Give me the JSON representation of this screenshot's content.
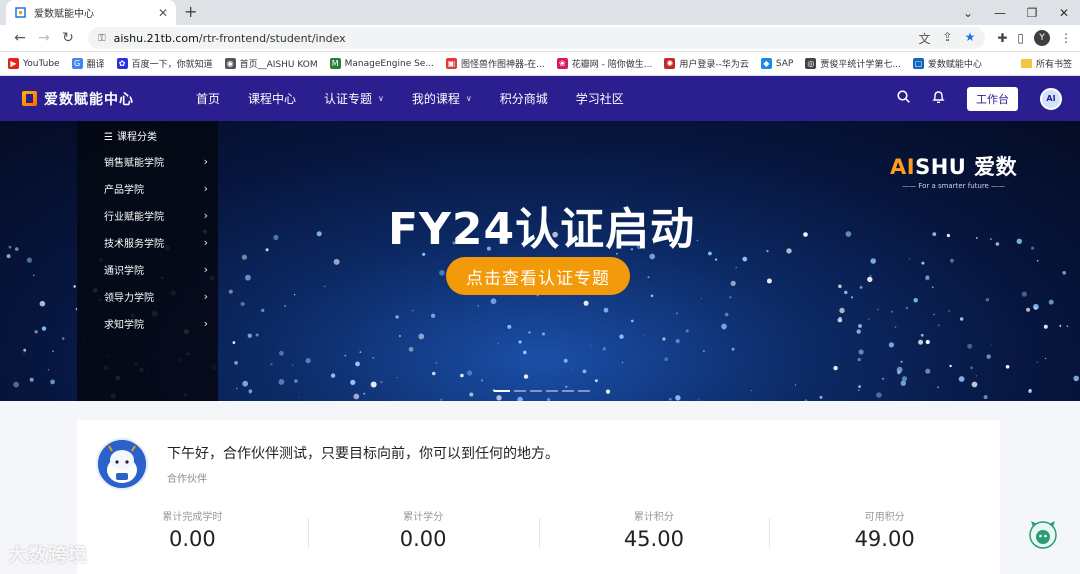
{
  "browser": {
    "tab_title": "爱数赋能中心",
    "new_tab": "+",
    "url_host": "aishu.21tb.com",
    "url_path": "/rtr-frontend/student/index",
    "profile_initial": "Y",
    "window_controls": [
      "⌄",
      "—",
      "❐",
      "✕"
    ]
  },
  "bookmarks": [
    {
      "label": "YouTube",
      "color": "#e62117",
      "icon": "▶"
    },
    {
      "label": "翻译",
      "color": "#4285f4",
      "icon": "G"
    },
    {
      "label": "百度一下，你就知道",
      "color": "#2932e1",
      "icon": "✿"
    },
    {
      "label": "首页__AISHU KOM",
      "color": "#555555",
      "icon": "◉"
    },
    {
      "label": "ManageEngine Se...",
      "color": "#2e7d32",
      "icon": "M"
    },
    {
      "label": "图怪兽作图神器-在...",
      "color": "#e53935",
      "icon": "▣"
    },
    {
      "label": "花瓣网 - 陪你做生...",
      "color": "#d81b60",
      "icon": "❀"
    },
    {
      "label": "用户登录--华为云",
      "color": "#c62828",
      "icon": "✺"
    },
    {
      "label": "SAP",
      "color": "#1e88e5",
      "icon": "◆"
    },
    {
      "label": "贾俊平统计学第七...",
      "color": "#444444",
      "icon": "◎"
    },
    {
      "label": "爱数赋能中心",
      "color": "#1565c0",
      "icon": "▢"
    }
  ],
  "bookmarks_all": "所有书签",
  "site": {
    "logo_text": "爱数赋能中心",
    "nav": [
      {
        "label": "首页",
        "dropdown": false
      },
      {
        "label": "课程中心",
        "dropdown": false
      },
      {
        "label": "认证专题",
        "dropdown": true
      },
      {
        "label": "我的课程",
        "dropdown": true
      },
      {
        "label": "积分商城",
        "dropdown": false
      },
      {
        "label": "学习社区",
        "dropdown": false
      }
    ],
    "workbench_button": "工作台",
    "avatar_text": "AI"
  },
  "banner": {
    "category_title": "课程分类",
    "categories": [
      "销售赋能学院",
      "产品学院",
      "行业赋能学院",
      "技术服务学院",
      "通识学院",
      "领导力学院",
      "求知学院"
    ],
    "brand_ai": "AI",
    "brand_rest": "SHU 爱数",
    "brand_tagline": "—— For a smarter future ——",
    "headline": "FY24认证启动",
    "cta": "点击查看认证专题",
    "slides": 6,
    "active_slide": 0
  },
  "welcome": {
    "greeting": "下午好，合作伙伴测试，只要目标向前，你可以到任何的地方。",
    "role": "合作伙伴",
    "stats": [
      {
        "label": "累计完成学时",
        "value": "0.00"
      },
      {
        "label": "累计学分",
        "value": "0.00"
      },
      {
        "label": "累计积分",
        "value": "45.00"
      },
      {
        "label": "可用积分",
        "value": "49.00"
      }
    ]
  },
  "watermark": "大数跨境",
  "colors": {
    "header": "#2b1f8f",
    "accent": "#f39a0a",
    "brand_orange": "#ff9c1a"
  }
}
